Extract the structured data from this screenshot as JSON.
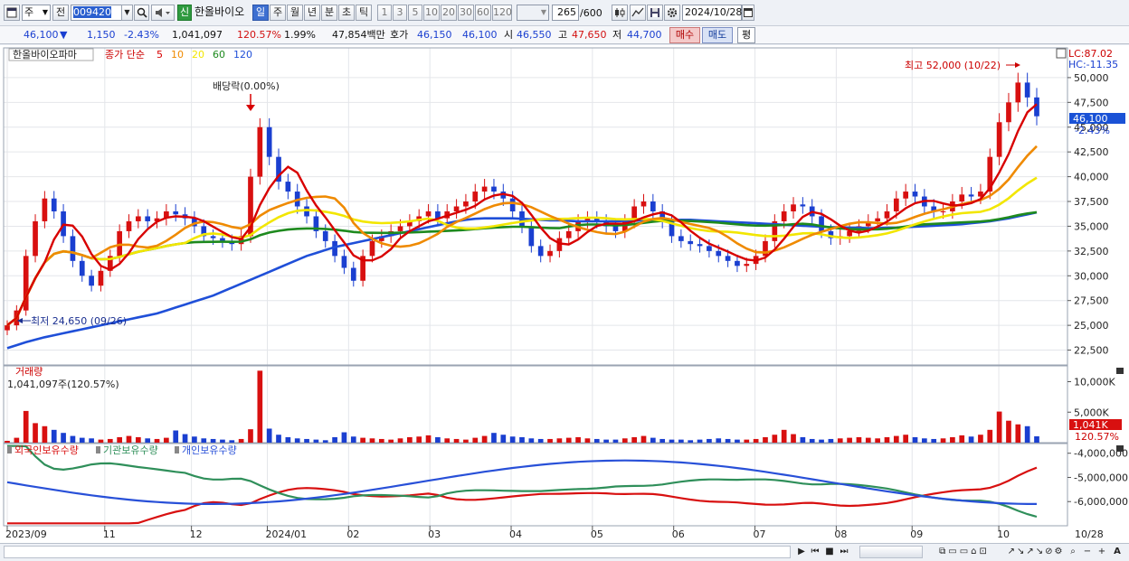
{
  "toolbar": {
    "period_main": "주",
    "period_prev": "전",
    "code": "009420",
    "new_badge": "신",
    "stock_name": "한올바이오",
    "period_tabs": [
      "일",
      "주",
      "월",
      "년",
      "분",
      "초",
      "틱"
    ],
    "interval_tabs": [
      "1",
      "3",
      "5",
      "10",
      "20",
      "30",
      "60",
      "120"
    ],
    "count": "265",
    "count_total": "/600",
    "date": "2024/10/28"
  },
  "quote": {
    "price": "46,100",
    "arrow": "▼",
    "change": "1,150",
    "change_pct": "-2.43%",
    "volume": "1,041,097",
    "volume_pct": "120.57%",
    "turnover_pct": "1.99%",
    "amount": "47,854백만",
    "ask_label": "호가",
    "ask1": "46,150",
    "ask2": "46,100",
    "open_label": "시",
    "open": "46,550",
    "high_label": "고",
    "high": "47,650",
    "low_label": "저",
    "low": "44,700",
    "buy_label": "매수",
    "sell_label": "매도",
    "avg_label": "평"
  },
  "chart_data": {
    "type": "line",
    "title": "한올바이오파마",
    "price_panel": {
      "legend_prefix": "종가 단순",
      "ma_periods": [
        "5",
        "10",
        "20",
        "60",
        "120"
      ],
      "ma_colors": [
        "#d80000",
        "#ef8a00",
        "#f2e600",
        "#1e8a1e",
        "#1f4fd8"
      ],
      "ylim": [
        21000,
        53000
      ],
      "yticks": [
        "50,000",
        "47,500",
        "45,000",
        "42,500",
        "40,000",
        "37,500",
        "35,000",
        "32,500",
        "30,000",
        "27,500",
        "25,000",
        "22,500"
      ],
      "lc_label": "LC:87.02",
      "hc_label": "HC:-11.35",
      "current_price": "46,100",
      "current_pct": "-2.43%",
      "high_annotation": "최고 52,000 (10/22)",
      "low_annotation": "최저 24,650 (09/26)",
      "dividend_annotation": "배당락(0.00%)",
      "close_series": [
        25000,
        26500,
        32000,
        35500,
        37800,
        36500,
        34000,
        31500,
        30000,
        29000,
        30500,
        32000,
        34500,
        35500,
        36000,
        35500,
        35800,
        36500,
        36200,
        35800,
        35000,
        34000,
        33800,
        33500,
        33200,
        34000,
        40000,
        45000,
        42000,
        39500,
        38500,
        37000,
        36000,
        34500,
        33500,
        32000,
        30800,
        29500,
        32000,
        33500,
        34000,
        34500,
        35000,
        35500,
        36000,
        36500,
        35800,
        36500,
        37000,
        37500,
        38500,
        39000,
        38500,
        37800,
        36500,
        35000,
        33000,
        32000,
        32500,
        33800,
        34500,
        35500,
        35800,
        35500,
        35000,
        34500,
        35500,
        37000,
        37500,
        36500,
        35500,
        34000,
        33500,
        33200,
        33000,
        32500,
        32000,
        31500,
        31000,
        31200,
        32000,
        33500,
        35500,
        36500,
        37200,
        37000,
        36000,
        34500,
        33800,
        34000,
        34500,
        35000,
        35500,
        35800,
        36500,
        37800,
        38500,
        38000,
        37000,
        36500,
        36500,
        37500,
        38200,
        38000,
        38500,
        42000,
        45500,
        47500,
        49500,
        48000,
        46100
      ],
      "ma120_series": [
        22700,
        23000,
        23300,
        23550,
        23800,
        24000,
        24200,
        24400,
        24600,
        24800,
        25000,
        25200,
        25400,
        25600,
        25800,
        26000,
        26200,
        26500,
        26800,
        27100,
        27400,
        27700,
        28000,
        28400,
        28800,
        29200,
        29600,
        30000,
        30400,
        30800,
        31200,
        31600,
        32000,
        32300,
        32600,
        32900,
        33100,
        33300,
        33500,
        33700,
        33900,
        34100,
        34300,
        34500,
        34700,
        34900,
        35100,
        35300,
        35500,
        35650,
        35750,
        35800,
        35800,
        35800,
        35800,
        35750,
        35700,
        35650,
        35600,
        35600,
        35550,
        35500,
        35500,
        35500,
        35500,
        35500,
        35550,
        35550,
        35600,
        35600,
        35600,
        35600,
        35650,
        35650,
        35600,
        35550,
        35500,
        35450,
        35400,
        35350,
        35300,
        35250,
        35200,
        35150,
        35100,
        35050,
        35000,
        34950,
        34900,
        34900,
        34850,
        34850,
        34800,
        34800,
        34850,
        34850,
        34900,
        34950,
        35000,
        35050,
        35100,
        35150,
        35200,
        35300,
        35400,
        35500,
        35650,
        35800,
        36000,
        36200,
        36400
      ]
    },
    "volume_panel": {
      "title": "거래량",
      "summary": "1,041,097주(120.57%)",
      "yticks": [
        "10,000K",
        "5,000K"
      ],
      "current": "1,041K",
      "current_pct": "120.57%",
      "ylim": [
        0,
        12000
      ],
      "values_k": [
        300,
        800,
        5200,
        3200,
        2700,
        2100,
        1600,
        1100,
        800,
        700,
        500,
        600,
        900,
        1100,
        900,
        700,
        600,
        800,
        2000,
        1400,
        1000,
        700,
        600,
        500,
        400,
        600,
        2200,
        11800,
        2300,
        1300,
        900,
        700,
        600,
        500,
        400,
        900,
        1700,
        1000,
        800,
        700,
        600,
        500,
        700,
        900,
        1000,
        1200,
        900,
        700,
        600,
        500,
        800,
        1100,
        1600,
        1300,
        1000,
        900,
        700,
        600,
        600,
        700,
        800,
        900,
        700,
        600,
        500,
        500,
        700,
        900,
        1100,
        800,
        600,
        500,
        500,
        400,
        500,
        600,
        700,
        600,
        500,
        500,
        600,
        900,
        1300,
        2100,
        1400,
        900,
        600,
        500,
        600,
        700,
        800,
        900,
        800,
        700,
        900,
        1100,
        1300,
        900,
        700,
        600,
        700,
        900,
        1200,
        1000,
        1300,
        2100,
        5100,
        3600,
        3000,
        2700,
        1041
      ]
    },
    "holding_panel": {
      "series_names": [
        "외국인보유수량",
        "기관보유수량",
        "개인보유수량"
      ],
      "series_colors": [
        "#d81010",
        "#2f8f5a",
        "#2850d8"
      ],
      "ylim": [
        -7000000,
        -3600000
      ],
      "yticks": [
        "-4,000,000",
        "-5,000,000",
        "-6,000,000"
      ]
    },
    "x_axis": {
      "ticks": [
        "2023/09",
        "11",
        "12",
        "2024/01",
        "02",
        "03",
        "04",
        "05",
        "06",
        "07",
        "08",
        "09",
        "10"
      ],
      "tick_index": [
        0,
        18,
        34,
        48,
        63,
        78,
        93,
        108,
        123,
        138,
        153,
        167,
        183
      ],
      "end_label": "10/28"
    }
  },
  "icons": {
    "window": "window-icon",
    "search": "search-icon",
    "sound": "speaker-icon",
    "candle": "candle-icon",
    "settings": "gear-icon",
    "save": "save-icon",
    "calendar": "calendar-icon"
  }
}
